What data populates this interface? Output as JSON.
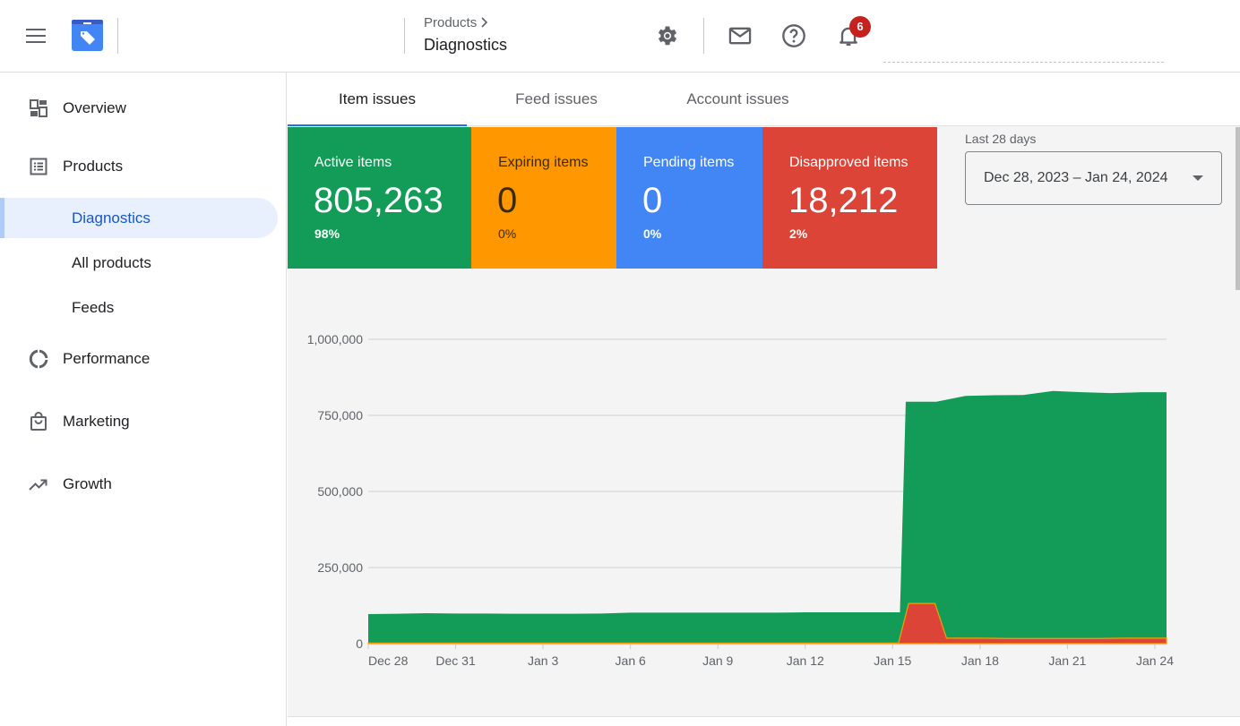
{
  "header": {
    "menu_icon": "hamburger-menu-icon",
    "logo_icon": "merchant-center-tag-icon",
    "breadcrumb_parent": "Products",
    "breadcrumb_separator_icon": "chevron-right-icon",
    "page_title": "Diagnostics",
    "icons": [
      "gear-icon",
      "mail-icon",
      "help-icon",
      "bell-icon"
    ],
    "notification_count": "6"
  },
  "sidebar": {
    "items": [
      {
        "label": "Overview",
        "icon": "dashboard-icon"
      },
      {
        "label": "Products",
        "icon": "list-icon"
      },
      {
        "label": "Diagnostics",
        "active": true
      },
      {
        "label": "All products"
      },
      {
        "label": "Feeds"
      },
      {
        "label": "Performance",
        "icon": "donut-icon"
      },
      {
        "label": "Marketing",
        "icon": "shopping-bag-icon"
      },
      {
        "label": "Growth",
        "icon": "trending-up-icon"
      }
    ]
  },
  "tabs": [
    {
      "label": "Item issues",
      "active": true
    },
    {
      "label": "Feed issues"
    },
    {
      "label": "Account issues"
    }
  ],
  "summary_cards": [
    {
      "title": "Active items",
      "value": "805,263",
      "percent": "98%",
      "color": "#129c57"
    },
    {
      "title": "Expiring items",
      "value": "0",
      "percent": "0%",
      "color": "#ff9800"
    },
    {
      "title": "Pending items",
      "value": "0",
      "percent": "0%",
      "color": "#4285f4"
    },
    {
      "title": "Disapproved items",
      "value": "18,212",
      "percent": "2%",
      "color": "#db4437"
    }
  ],
  "date_range": {
    "label": "Last 28 days",
    "value": "Dec 28, 2023 – Jan 24, 2024",
    "dropdown_icon": "caret-down-icon"
  },
  "chart_data": {
    "type": "area",
    "title": "",
    "xlabel": "",
    "ylabel": "",
    "ylim": [
      0,
      1000000
    ],
    "grid": true,
    "legend": "none",
    "y_ticks": [
      "0",
      "250,000",
      "500,000",
      "750,000",
      "1,000,000"
    ],
    "y_tick_values": [
      0,
      250000,
      500000,
      750000,
      1000000
    ],
    "x_tick_labels": [
      "Dec 28",
      "Dec 31",
      "Jan 3",
      "Jan 6",
      "Jan 9",
      "Jan 12",
      "Jan 15",
      "Jan 18",
      "Jan 21",
      "Jan 24"
    ],
    "x_tick_index": [
      0,
      3,
      6,
      9,
      12,
      15,
      18,
      21,
      24,
      27
    ],
    "x": [
      "Dec 28",
      "Dec 29",
      "Dec 30",
      "Dec 31",
      "Jan 1",
      "Jan 2",
      "Jan 3",
      "Jan 4",
      "Jan 5",
      "Jan 6",
      "Jan 7",
      "Jan 8",
      "Jan 9",
      "Jan 10",
      "Jan 11",
      "Jan 12",
      "Jan 13",
      "Jan 14",
      "Jan 15",
      "Jan 16",
      "Jan 17",
      "Jan 18",
      "Jan 19",
      "Jan 20",
      "Jan 21",
      "Jan 22",
      "Jan 23",
      "Jan 24"
    ],
    "series": [
      {
        "name": "Active items",
        "color": "#129c57",
        "values": [
          97000,
          98000,
          100000,
          99000,
          99000,
          98000,
          98000,
          98000,
          99000,
          102000,
          102000,
          102000,
          102000,
          102000,
          102000,
          103000,
          103000,
          103000,
          103000,
          795000,
          795000,
          814000,
          816000,
          817000,
          830000,
          826000,
          823000,
          826000
        ]
      },
      {
        "name": "Expiring items",
        "color": "#ff9800",
        "values": [
          0,
          0,
          0,
          0,
          0,
          0,
          0,
          0,
          0,
          0,
          0,
          0,
          0,
          0,
          0,
          0,
          0,
          0,
          0,
          0,
          0,
          0,
          0,
          0,
          0,
          0,
          0,
          0
        ]
      },
      {
        "name": "Pending items",
        "color": "#4285f4",
        "values": [
          0,
          0,
          0,
          0,
          0,
          0,
          0,
          0,
          0,
          0,
          0,
          0,
          0,
          0,
          0,
          0,
          0,
          0,
          0,
          0,
          0,
          0,
          0,
          0,
          0,
          0,
          0,
          0
        ]
      },
      {
        "name": "Disapproved items",
        "color": "#db4437",
        "values": [
          2000,
          2000,
          2000,
          2000,
          2000,
          2000,
          2000,
          2000,
          2000,
          2000,
          2000,
          2000,
          2000,
          2000,
          2000,
          2000,
          2000,
          2000,
          2000,
          132000,
          132000,
          18000,
          18000,
          17000,
          17000,
          17000,
          17000,
          18000
        ]
      }
    ]
  }
}
